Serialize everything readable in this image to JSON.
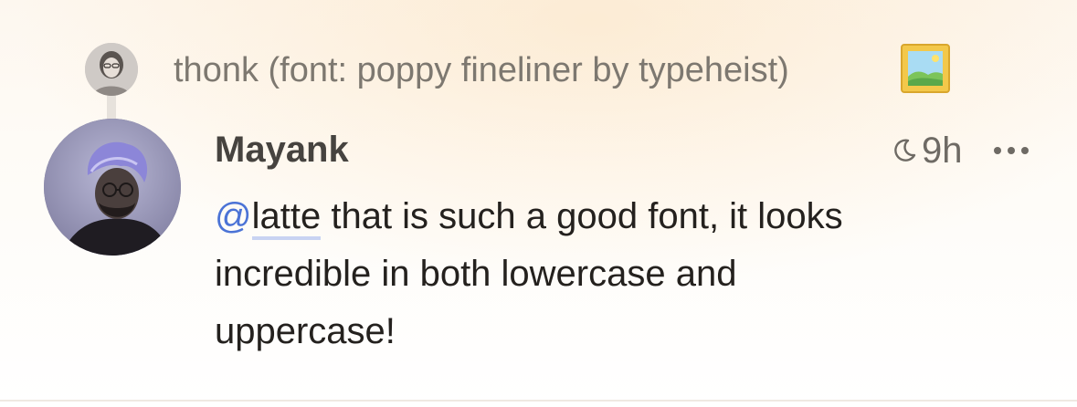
{
  "reply_context": {
    "text": "thonk (font: poppy fineliner by typeheist)",
    "emoji_icon": "framed-picture-icon"
  },
  "post": {
    "author": "Mayank",
    "time_icon": "crescent-moon-icon",
    "time": "9h",
    "mention_prefix": "@",
    "mention_handle": "latte",
    "body_rest": " that is such a good font, it looks incredible in both lowercase and uppercase!",
    "more_icon": "more-horizontal-icon"
  },
  "colors": {
    "mention": "#4b73d6",
    "mention_underline": "#c8d3f2",
    "muted_text": "#7d7870",
    "body_text": "#24211e"
  }
}
